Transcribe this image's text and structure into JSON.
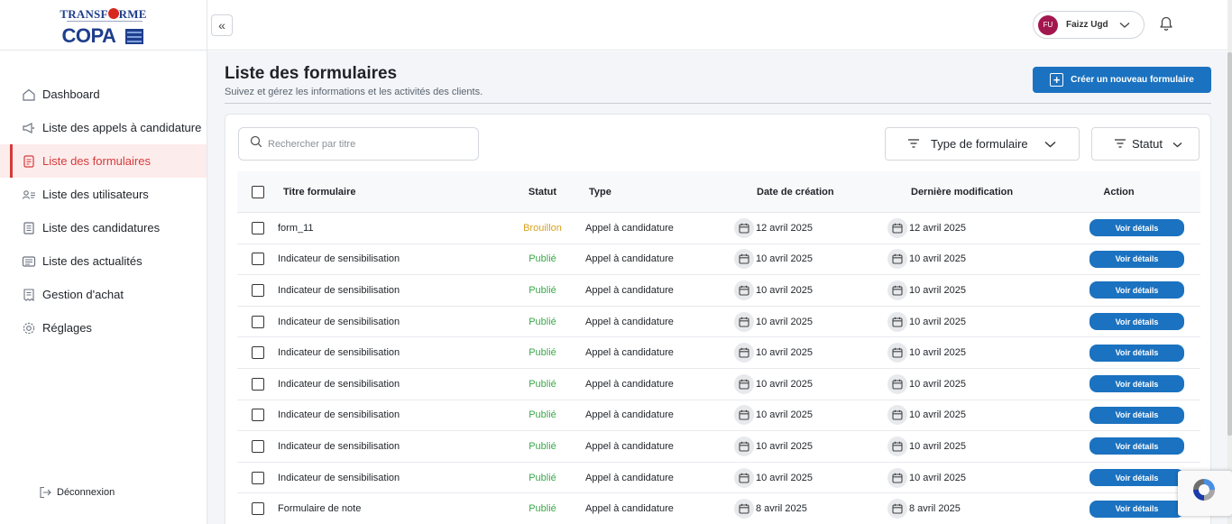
{
  "brand": {
    "logo_top": "TRANSF",
    "logo_top_end": "RME",
    "logo_main": "COPA"
  },
  "sidebar": {
    "items": [
      {
        "label": "Dashboard",
        "icon": "home-icon"
      },
      {
        "label": "Liste des appels à candidature",
        "icon": "megaphone-icon"
      },
      {
        "label": "Liste des formulaires",
        "icon": "form-icon",
        "active": true
      },
      {
        "label": "Liste des utilisateurs",
        "icon": "users-icon"
      },
      {
        "label": "Liste des candidatures",
        "icon": "document-icon"
      },
      {
        "label": "Liste des actualités",
        "icon": "news-icon"
      },
      {
        "label": "Gestion d'achat",
        "icon": "receipt-icon"
      },
      {
        "label": "Réglages",
        "icon": "gear-icon"
      }
    ],
    "logout_label": "Déconnexion"
  },
  "header": {
    "collapse_label": "«",
    "user_initials": "FU",
    "user_name": "Faizz Ugd"
  },
  "page": {
    "title": "Liste des formulaires",
    "subtitle": "Suivez et gérez les informations et les activités des clients.",
    "create_button": "Créer un nouveau formulaire"
  },
  "filters": {
    "search_placeholder": "Rechercher par titre",
    "type_label": "Type de formulaire",
    "status_label": "Statut"
  },
  "table": {
    "headers": {
      "title": "Titre formulaire",
      "status": "Statut",
      "type": "Type",
      "created": "Date de création",
      "modified": "Dernière modification",
      "action": "Action"
    },
    "rows": [
      {
        "title": "form_11",
        "status": "Brouillon",
        "type": "Appel à candidature",
        "created": "12 avril 2025",
        "modified": "12 avril 2025",
        "action": "Voir détails"
      },
      {
        "title": "Indicateur de sensibilisation",
        "status": "Publié",
        "type": "Appel à candidature",
        "created": "10 avril 2025",
        "modified": "10 avril 2025",
        "action": "Voir détails"
      },
      {
        "title": "Indicateur de sensibilisation",
        "status": "Publié",
        "type": "Appel à candidature",
        "created": "10 avril 2025",
        "modified": "10 avril 2025",
        "action": "Voir détails"
      },
      {
        "title": "Indicateur de sensibilisation",
        "status": "Publié",
        "type": "Appel à candidature",
        "created": "10 avril 2025",
        "modified": "10 avril 2025",
        "action": "Voir détails"
      },
      {
        "title": "Indicateur de sensibilisation",
        "status": "Publié",
        "type": "Appel à candidature",
        "created": "10 avril 2025",
        "modified": "10 avril 2025",
        "action": "Voir détails"
      },
      {
        "title": "Indicateur de sensibilisation",
        "status": "Publié",
        "type": "Appel à candidature",
        "created": "10 avril 2025",
        "modified": "10 avril 2025",
        "action": "Voir détails"
      },
      {
        "title": "Indicateur de sensibilisation",
        "status": "Publié",
        "type": "Appel à candidature",
        "created": "10 avril 2025",
        "modified": "10 avril 2025",
        "action": "Voir détails"
      },
      {
        "title": "Indicateur de sensibilisation",
        "status": "Publié",
        "type": "Appel à candidature",
        "created": "10 avril 2025",
        "modified": "10 avril 2025",
        "action": "Voir détails"
      },
      {
        "title": "Indicateur de sensibilisation",
        "status": "Publié",
        "type": "Appel à candidature",
        "created": "10 avril 2025",
        "modified": "10 avril 2025",
        "action": "Voir détails"
      },
      {
        "title": "Formulaire de note",
        "status": "Publié",
        "type": "Appel à candidature",
        "created": "8 avril 2025",
        "modified": "8 avril 2025",
        "action": "Voir détails"
      }
    ]
  },
  "colors": {
    "accent": "#1b72c0",
    "active_nav": "#d63a3a",
    "draft": "#d8a21e",
    "published": "#3ba84a"
  }
}
